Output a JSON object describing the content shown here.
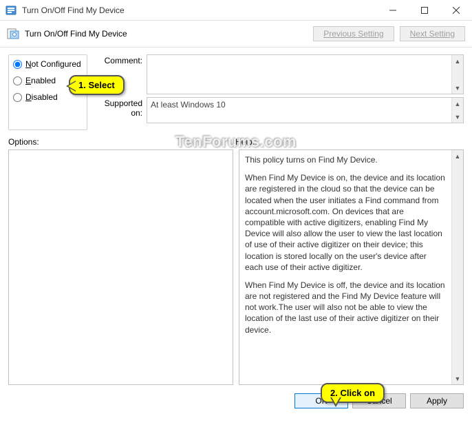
{
  "window": {
    "title": "Turn On/Off Find My Device"
  },
  "toolbar": {
    "title": "Turn On/Off Find My Device",
    "prev": "Previous Setting",
    "next": "Next Setting"
  },
  "radios": {
    "not_configured": "ot Configured",
    "not_configured_u": "N",
    "enabled": "nabled",
    "enabled_u": "E",
    "disabled": "isabled",
    "disabled_u": "D"
  },
  "labels": {
    "comment": "Comment:",
    "supported": "Supported on:",
    "options": "Options:",
    "help": "Help:"
  },
  "supported_text": "At least Windows 10",
  "help_text": {
    "p1": "This policy turns on Find My Device.",
    "p2": "When Find My Device is on, the device and its location are registered in the cloud so that the device can be located when the user initiates a Find command from account.microsoft.com. On devices that are compatible with active digitizers, enabling Find My Device will also allow the user to view the last location of use of their active digitizer on their device; this location is stored locally on the user's device after each use of their active digitizer.",
    "p3": "When Find My Device is off, the device and its location are not registered and the Find My Device feature will not work.The user will also not be able to view the location of the last use of their active digitizer on their device."
  },
  "buttons": {
    "ok": "OK",
    "cancel": "Cancel",
    "apply": "Apply"
  },
  "callouts": {
    "c1": "1. Select",
    "c2": "2. Click on"
  },
  "watermark": "TenForums.com"
}
